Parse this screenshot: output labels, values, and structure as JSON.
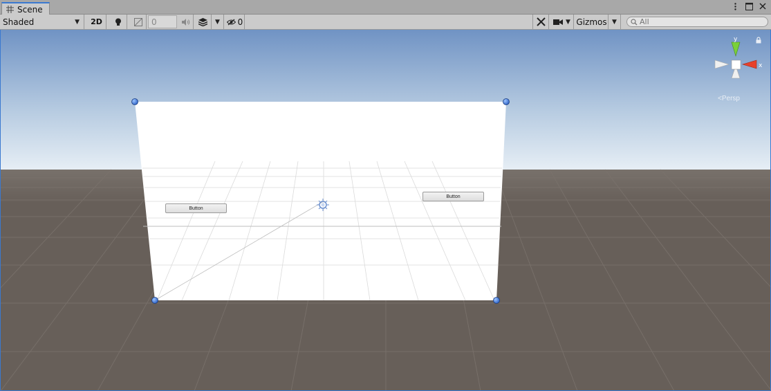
{
  "tab": {
    "title": "Scene"
  },
  "toolbar": {
    "shading_mode": "Shaded",
    "mode_2d": "2D",
    "number_field_value": "0",
    "hidden_count": "0",
    "gizmos_label": "Gizmos",
    "search_placeholder": "All"
  },
  "viewport": {
    "canvas_buttons": [
      {
        "label": "Button"
      },
      {
        "label": "Button"
      }
    ],
    "orientation": {
      "y_label": "y",
      "x_label": "x",
      "projection": "Persp"
    }
  },
  "colors": {
    "accent": "#3a79d0",
    "sky_top": "#7093c4",
    "sky_horizon": "#e6eef5",
    "ground": "#675f59",
    "axis_x": "#e8412b",
    "axis_y": "#7ad03a"
  }
}
